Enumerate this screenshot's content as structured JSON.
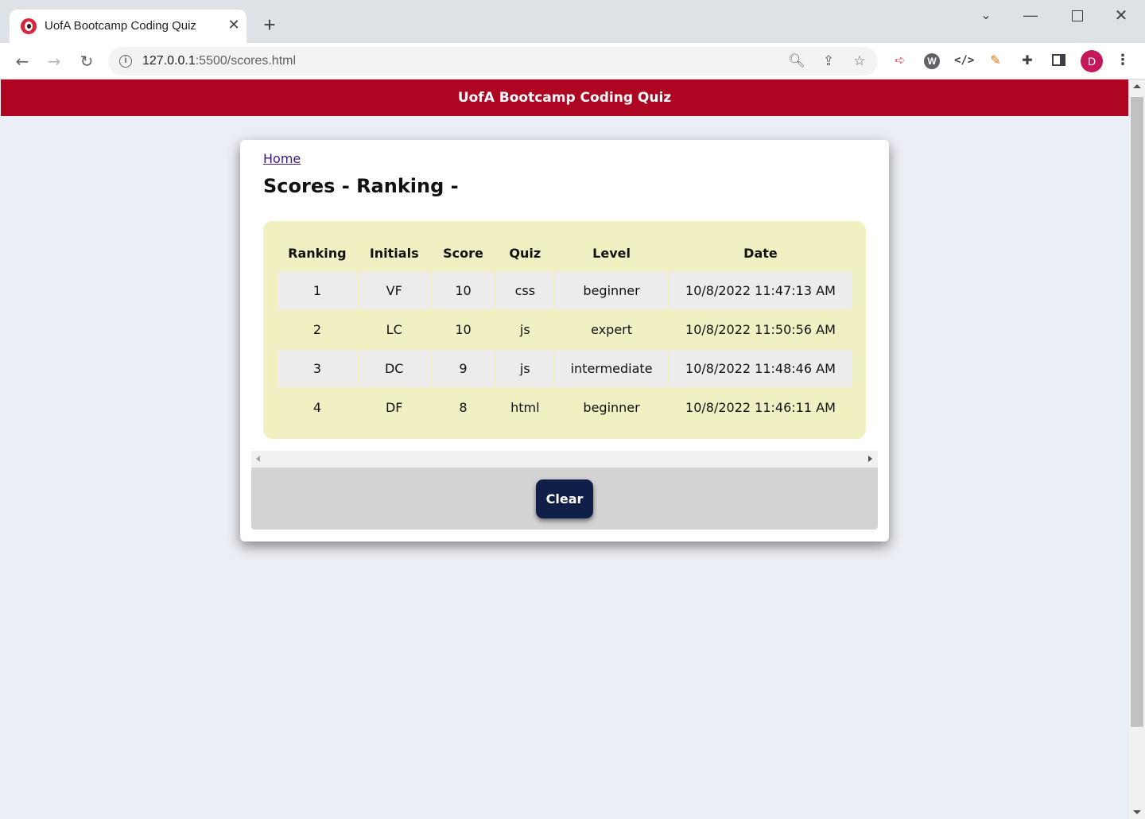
{
  "browser": {
    "tab_title": "UofA Bootcamp Coding Quiz",
    "tab_close": "✕",
    "new_tab": "+",
    "url_host": "127.0.0.1",
    "url_path": ":5500/scores.html",
    "avatar_initial": "D",
    "icons": {
      "favicon": "quiz-favicon-icon",
      "back": "arrow-left-icon",
      "forward": "arrow-right-icon",
      "reload": "reload-icon",
      "info": "info-icon",
      "zoom": "zoom-out-icon",
      "share": "share-icon",
      "bookmark": "star-icon",
      "extensions": "puzzle-icon",
      "side_panel": "side-panel-icon",
      "menu": "kebab-menu-icon"
    }
  },
  "header": {
    "title": "UofA Bootcamp Coding Quiz",
    "background": "#ae0622"
  },
  "card": {
    "home_link": "Home",
    "title": "Scores - Ranking -",
    "table": {
      "columns": [
        "Ranking",
        "Initials",
        "Score",
        "Quiz",
        "Level",
        "Date"
      ],
      "rows": [
        [
          "1",
          "VF",
          "10",
          "css",
          "beginner",
          "10/8/2022 11:47:13 AM"
        ],
        [
          "2",
          "LC",
          "10",
          "js",
          "expert",
          "10/8/2022 11:50:56 AM"
        ],
        [
          "3",
          "DC",
          "9",
          "js",
          "intermediate",
          "10/8/2022 11:48:46 AM"
        ],
        [
          "4",
          "DF",
          "8",
          "html",
          "beginner",
          "10/8/2022 11:46:11 AM"
        ]
      ],
      "background": "#f0f0c3"
    },
    "clear_button": "Clear",
    "clear_button_color": "#0f1f47"
  }
}
